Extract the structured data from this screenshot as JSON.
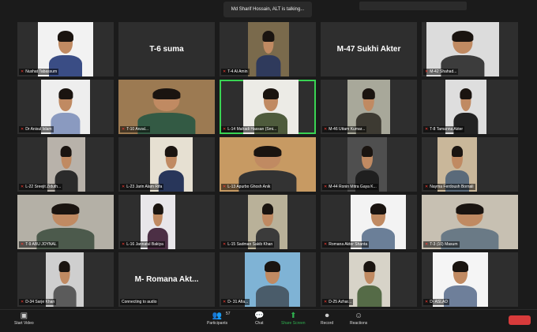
{
  "talking_banner": "Md Sharif Hossain, ALT is talking...",
  "tiles": [
    {
      "label": "Nushat Tabassum",
      "bg": "#f2f2f2",
      "body": "#3a4d85"
    },
    {
      "label": "",
      "bigname": "T-6 suma"
    },
    {
      "label": "T-4 Al Amin",
      "bg": "#7a6a4c",
      "body": "#2f3a5c"
    },
    {
      "label": "",
      "bigname": "M-47 Sukhi Akter"
    },
    {
      "label": "M-42 Shahad...",
      "bg": "#dcdcdc",
      "body": "#3c3c3c"
    },
    {
      "label": "Dr Anisul Islam",
      "bg": "#eeeeee",
      "body": "#8a9ac0"
    },
    {
      "label": "T-10 Anzal...",
      "bg": "#9c7a52",
      "body": "#335a44"
    },
    {
      "label": "L-14 Mahadi Hassan (Smi...",
      "bg": "#ecebe6",
      "body": "#4e5b3c",
      "highlight": true
    },
    {
      "label": "M-46 Uttam Kumar...",
      "bg": "#a8a89a",
      "body": "#3d3a32"
    },
    {
      "label": "T-8 Tamanna Akter",
      "bg": "#dedede",
      "body": "#222222"
    },
    {
      "label": "L-22 Sreejit Ziduth...",
      "bg": "#b8b2aa",
      "body": "#2b2b2b"
    },
    {
      "label": "L-23 Jarin Alam Rifa",
      "bg": "#e6e0d2",
      "body": "#28365a"
    },
    {
      "label": "L-13 Apurbo Ghosh Anik",
      "bg": "#c79a63",
      "body": "#333333"
    },
    {
      "label": "M-44 Ronin Mitra Gaya K...",
      "bg": "#4f4f4f",
      "body": "#1f1f1f"
    },
    {
      "label": "Nayma Ferdoush Bornali",
      "bg": "#c9b79a",
      "body": "#5a6a7a"
    },
    {
      "label": "T-9 ABU JOYNAL",
      "bg": "#b4b0a6",
      "body": "#4c5a4c"
    },
    {
      "label": "L-16 Jannatul Bakiya",
      "bg": "#e8e6ea",
      "body": "#4c2f45"
    },
    {
      "label": "L-15 Sadman Sakib Khan",
      "bg": "#b9b199",
      "body": "#3b3b3b"
    },
    {
      "label": "Romana Akter Shanta",
      "bg": "#f3f3f3",
      "body": "#6b7f98"
    },
    {
      "label": "T-3 (10) Masum",
      "bg": "#c7c0b2",
      "body": "#6a7a86"
    },
    {
      "label": "D-34 Sarje Khan",
      "bg": "#cfcfcf",
      "body": "#5b5b5b"
    },
    {
      "label": "Connecting to audio",
      "bigname": "M- Romana Akt..."
    },
    {
      "label": "D- 31 Afia...",
      "bg": "#7fb3d5",
      "body": "#4a5c6a"
    },
    {
      "label": "D-25 Azhar...",
      "bg": "#d7d3c8",
      "body": "#556b47"
    },
    {
      "label": "D- ASLAD",
      "bg": "#f5f5f5",
      "body": "#6e7f9a"
    }
  ],
  "toolbar": {
    "start_video": "Start Video",
    "participants": "Participants",
    "participants_count": "57",
    "chat": "Chat",
    "share_screen": "Share Screen",
    "record": "Record",
    "reactions": "Reactions"
  },
  "icons": {
    "video": "video-icon",
    "participants": "participants-icon",
    "chat": "chat-icon",
    "share": "share-screen-icon",
    "record": "record-icon",
    "reactions": "reactions-icon"
  }
}
